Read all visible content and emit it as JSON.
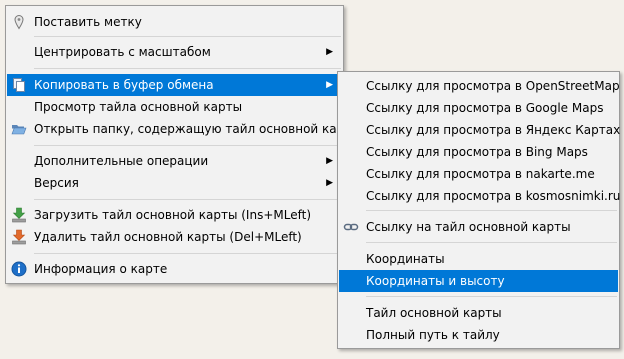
{
  "main_menu": {
    "items": [
      {
        "label": "Поставить метку",
        "icon": "map-pin-icon"
      },
      {
        "label": "Центрировать с масштабом",
        "submenu": true
      },
      {
        "label": "Копировать в буфер обмена",
        "icon": "copy-icon",
        "submenu": true,
        "highlighted": true
      },
      {
        "label": "Просмотр тайла основной карты"
      },
      {
        "label": "Открыть папку, содержащую тайл основной карты",
        "icon": "folder-open-icon"
      },
      {
        "label": "Дополнительные операции",
        "submenu": true
      },
      {
        "label": "Версия",
        "submenu": true
      },
      {
        "label": "Загрузить тайл основной карты (Ins+MLeft)",
        "icon": "download-icon"
      },
      {
        "label": "Удалить тайл основной карты (Del+MLeft)",
        "icon": "delete-icon"
      },
      {
        "label": "Информация о карте",
        "icon": "info-icon"
      }
    ]
  },
  "copy_submenu": {
    "items": [
      {
        "label": "Ссылку для просмотра в OpenStreetMap"
      },
      {
        "label": "Ссылку для просмотра в Google Maps"
      },
      {
        "label": "Ссылку для просмотра в Яндекс Картах"
      },
      {
        "label": "Ссылку для просмотра в Bing Maps"
      },
      {
        "label": "Ссылку для просмотра в nakarte.me"
      },
      {
        "label": "Ссылку для просмотра в kosmosnimki.ru"
      },
      {
        "label": "Ссылку на тайл основной карты",
        "icon": "link-icon"
      },
      {
        "label": "Координаты"
      },
      {
        "label": "Координаты и высоту",
        "highlighted": true
      },
      {
        "label": "Тайл основной карты"
      },
      {
        "label": "Полный путь к тайлу"
      }
    ]
  },
  "arrow_glyph": "▶",
  "colors": {
    "highlight": "#0078d7",
    "menu_bg": "#f2f2f2",
    "desktop_bg": "#f3f0ea"
  }
}
